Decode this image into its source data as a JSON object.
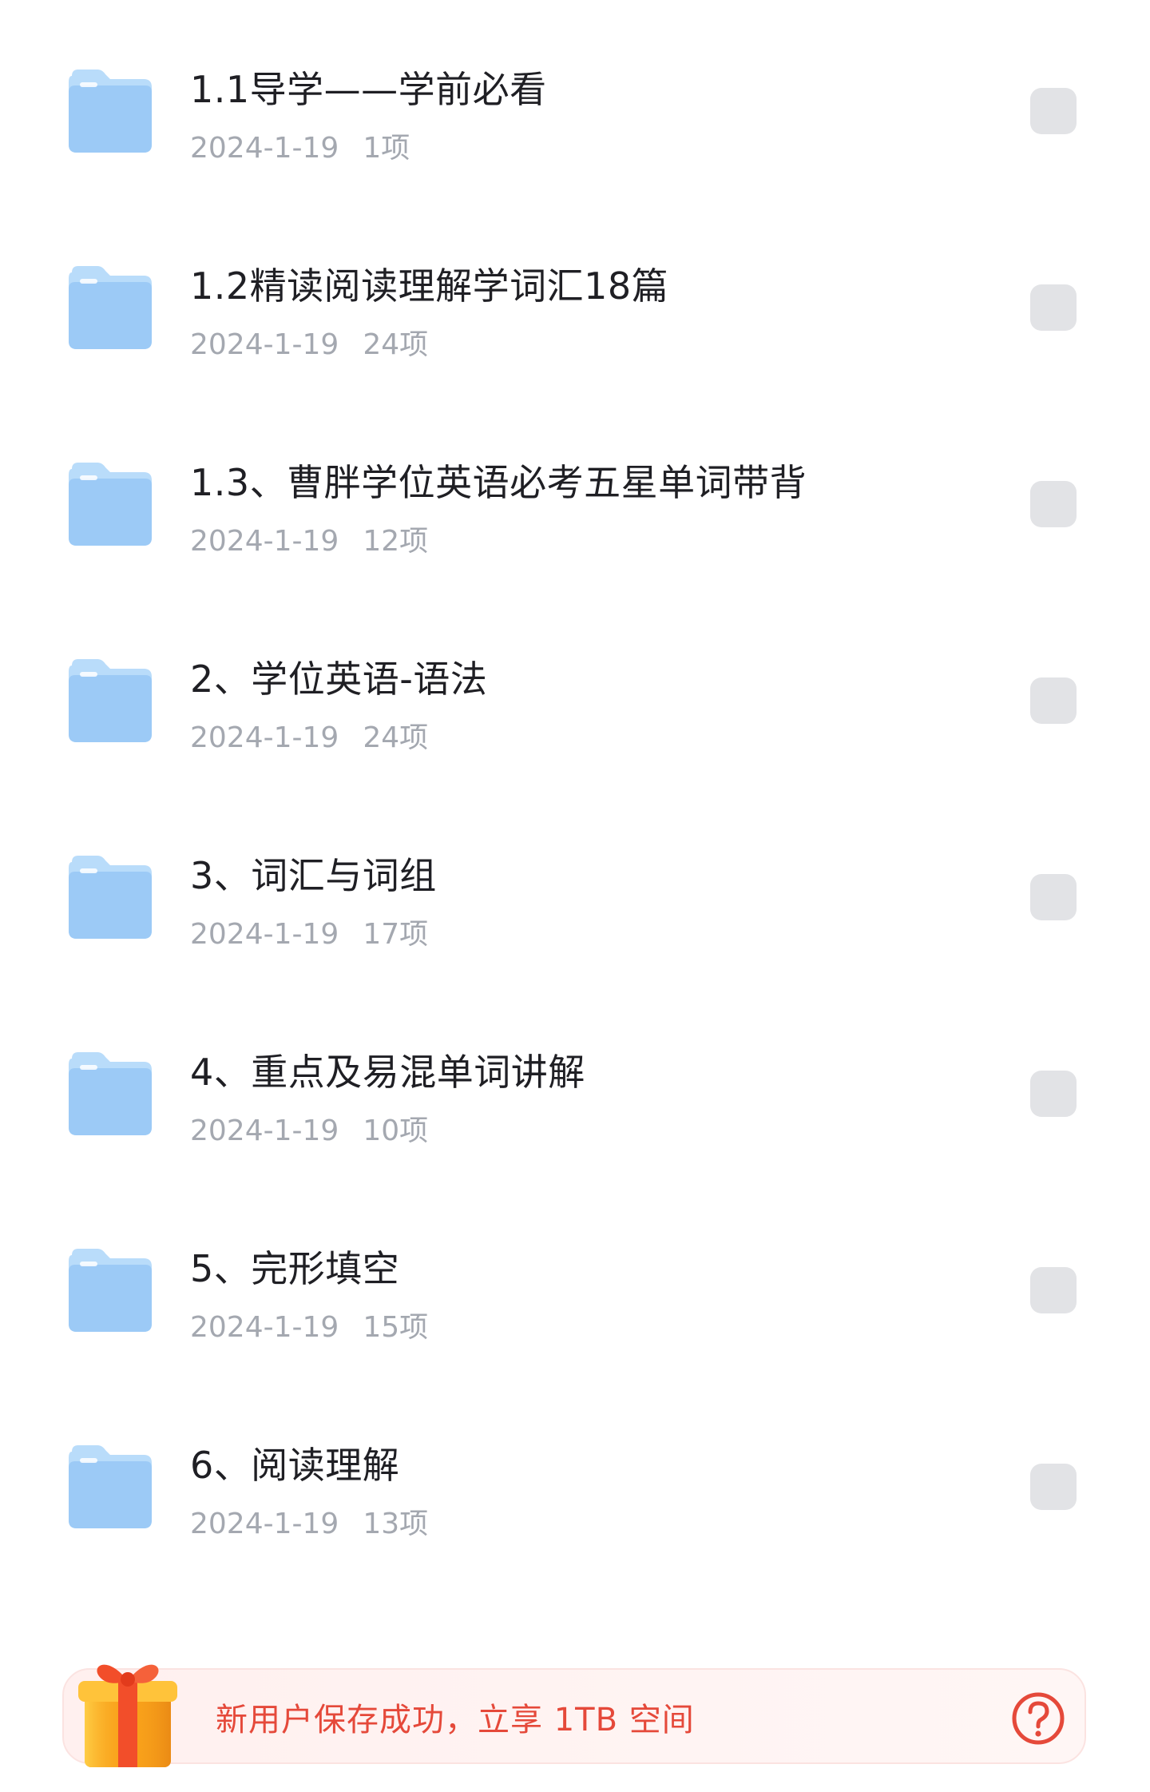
{
  "folders": [
    {
      "name": "1.1导学——学前必看",
      "date": "2024-1-19",
      "count": "1项"
    },
    {
      "name": "1.2精读阅读理解学词汇18篇",
      "date": "2024-1-19",
      "count": "24项"
    },
    {
      "name": "1.3、曹胖学位英语必考五星单词带背",
      "date": "2024-1-19",
      "count": "12项"
    },
    {
      "name": "2、学位英语-语法",
      "date": "2024-1-19",
      "count": "24项"
    },
    {
      "name": "3、词汇与词组",
      "date": "2024-1-19",
      "count": "17项"
    },
    {
      "name": "4、重点及易混单词讲解",
      "date": "2024-1-19",
      "count": "10项"
    },
    {
      "name": "5、完形填空",
      "date": "2024-1-19",
      "count": "15项"
    },
    {
      "name": "6、阅读理解",
      "date": "2024-1-19",
      "count": "13项"
    }
  ],
  "icons": {
    "folder": "folder-icon",
    "checkbox": "checkbox",
    "gift": "gift-icon",
    "help": "help-icon"
  },
  "promo": {
    "text": "新用户保存成功，立享 1TB 空间"
  },
  "colors": {
    "folder_blue": "#9ccaf6",
    "promo_red": "#e5493a",
    "checkbox_gray": "#e2e3e6"
  }
}
